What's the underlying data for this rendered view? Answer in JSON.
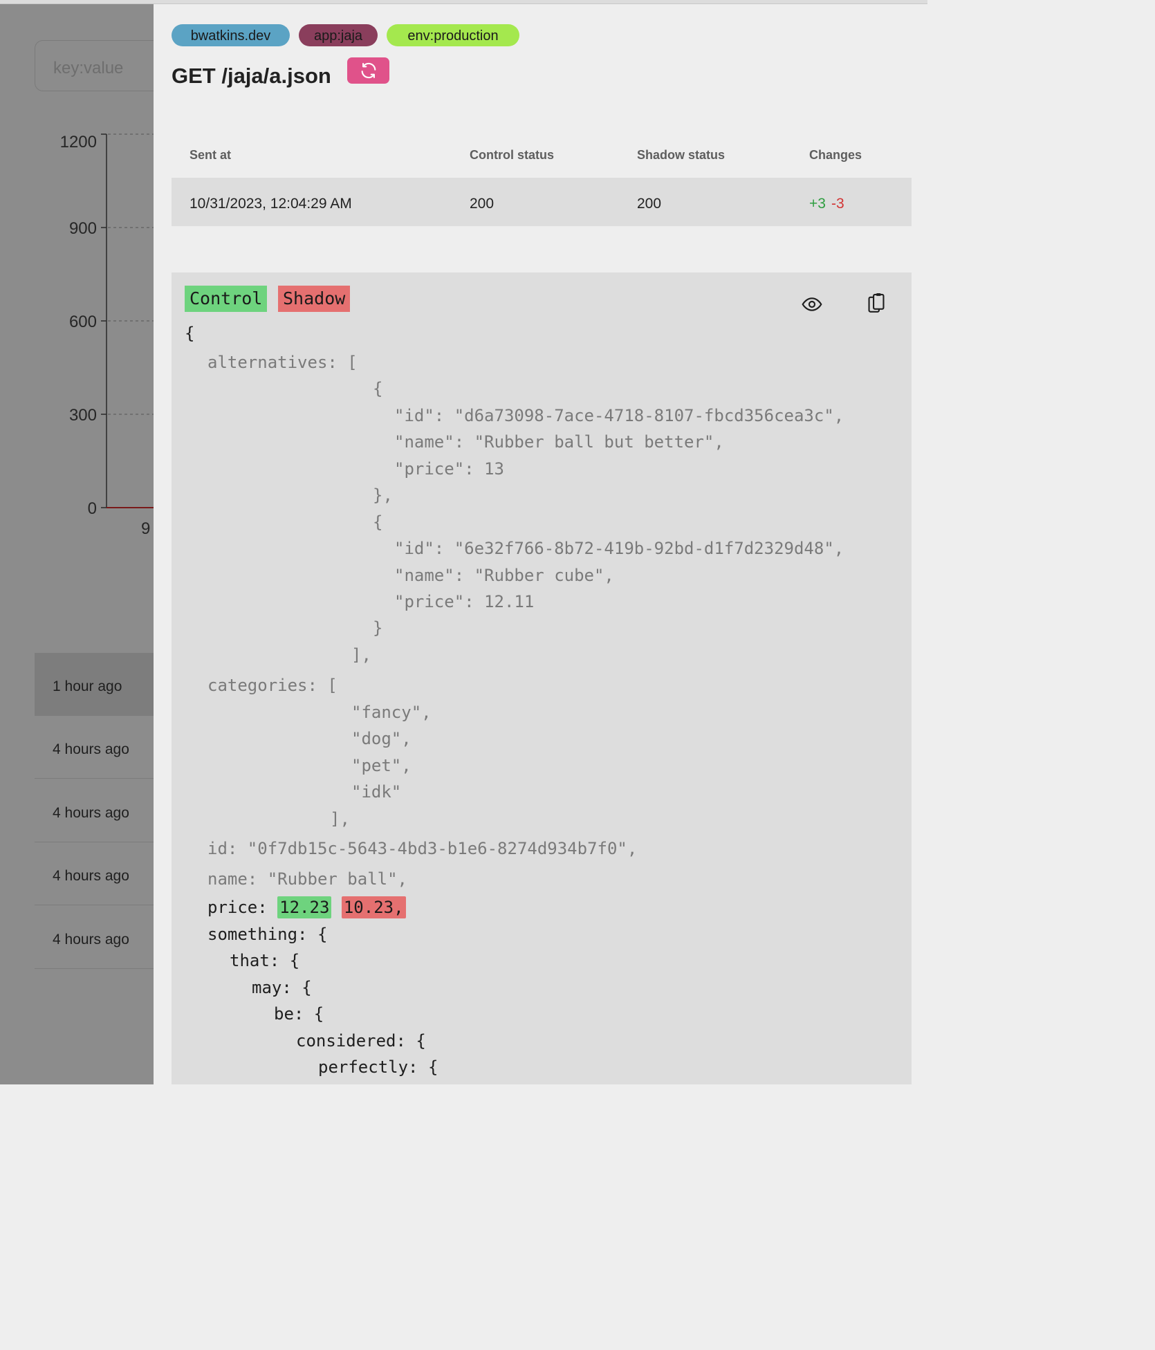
{
  "background": {
    "search_placeholder": "key:value",
    "chart": {
      "y_ticks": [
        "1200",
        "900",
        "600",
        "300",
        "0"
      ],
      "x_tick_partial": "9"
    },
    "history": [
      "1 hour ago",
      "4 hours ago",
      "4 hours ago",
      "4 hours ago",
      "4 hours ago"
    ]
  },
  "panel": {
    "tags": [
      {
        "label": "bwatkins.dev",
        "color": "#5ba3c4"
      },
      {
        "label": "app:jaja",
        "color": "#8a3e5c"
      },
      {
        "label": "env:production",
        "color": "#a4e84e"
      }
    ],
    "title": "GET /jaja/a.json",
    "refresh_icon": "refresh-icon",
    "table": {
      "headers": {
        "sent_at": "Sent at",
        "control_status": "Control status",
        "shadow_status": "Shadow status",
        "changes": "Changes"
      },
      "row": {
        "sent_at": "10/31/2023, 12:04:29 AM",
        "control_status": "200",
        "shadow_status": "200",
        "additions": "+3",
        "removals": "-3"
      }
    },
    "diff": {
      "legend_control": "Control",
      "legend_shadow": "Shadow",
      "eye_icon": "eye-icon",
      "clipboard_icon": "clipboard-icon",
      "lines": {
        "open": "{",
        "alternatives_key": "alternatives:",
        "alternatives_open": " [",
        "alt1_open": "{",
        "alt1_id": "\"id\": \"d6a73098-7ace-4718-8107-fbcd356cea3c\",",
        "alt1_name": "\"name\": \"Rubber ball but better\",",
        "alt1_price": "\"price\": 13",
        "alt1_close": "},",
        "alt2_open": "{",
        "alt2_id": "\"id\": \"6e32f766-8b72-419b-92bd-d1f7d2329d48\",",
        "alt2_name": "\"name\": \"Rubber cube\",",
        "alt2_price": "\"price\": 12.11",
        "alt2_close": "}",
        "alternatives_close": "],",
        "categories_key": "categories:",
        "categories_open": " [",
        "cat_fancy": "\"fancy\",",
        "cat_dog": "\"dog\",",
        "cat_pet": "\"pet\",",
        "cat_idk": "\"idk\"",
        "categories_close": "],",
        "id_key": "id:",
        "id_value": " \"0f7db15c-5643-4bd3-b1e6-8274d934b7f0\",",
        "name_key": "name:",
        "name_value": " \"Rubber ball\",",
        "price_key": "price:",
        "price_control": "12.23",
        "price_shadow": "10.23,",
        "something": "something: {",
        "that": "that: {",
        "may": "may: {",
        "be": "be: {",
        "considered": "considered: {",
        "perfectly": "perfectly: {"
      }
    }
  }
}
